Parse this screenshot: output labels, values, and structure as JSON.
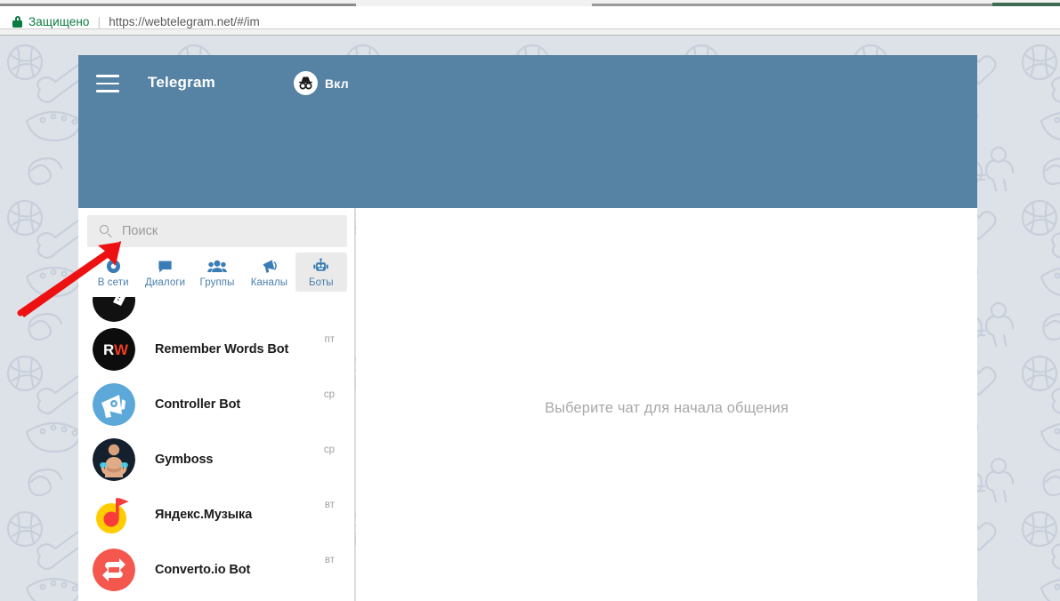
{
  "browser": {
    "security_label": "Защищено",
    "url": "https://webtelegram.net/#/im",
    "lock_icon": "lock-icon",
    "separator": "|"
  },
  "app": {
    "title": "Telegram",
    "menu_icon": "hamburger-menu-icon",
    "incognito": {
      "icon": "incognito-icon",
      "label": "Вкл"
    },
    "header_color": "#5682a3"
  },
  "sidebar": {
    "search": {
      "placeholder": "Поиск",
      "value": "",
      "icon": "search-icon"
    },
    "tabs": [
      {
        "label": "В сети",
        "icon": "online-dot-icon",
        "active": false
      },
      {
        "label": "Диалоги",
        "icon": "chat-bubble-icon",
        "active": false
      },
      {
        "label": "Группы",
        "icon": "group-people-icon",
        "active": false
      },
      {
        "label": "Каналы",
        "icon": "megaphone-icon",
        "active": false
      },
      {
        "label": "Боты",
        "icon": "robot-icon",
        "active": true
      }
    ],
    "tab_accent_color": "#4a7fad",
    "chats": [
      {
        "name": "",
        "time": "",
        "avatar_kind": "cut-off-black"
      },
      {
        "name": "Remember Words Bot",
        "time": "пт",
        "avatar_kind": "rw-black"
      },
      {
        "name": "Controller Bot",
        "time": "ср",
        "avatar_kind": "megaphone-blue"
      },
      {
        "name": "Gymboss",
        "time": "ср",
        "avatar_kind": "gymboss-photo"
      },
      {
        "name": "Яндекс.Музыка",
        "time": "вт",
        "avatar_kind": "yandex-music"
      },
      {
        "name": "Converto.io Bot",
        "time": "вт",
        "avatar_kind": "converto-red"
      }
    ]
  },
  "main": {
    "empty_message": "Выберите чат для начала общения"
  },
  "annotation": {
    "arrow_color": "#ee1111",
    "arrow_points_to": "search-input"
  }
}
